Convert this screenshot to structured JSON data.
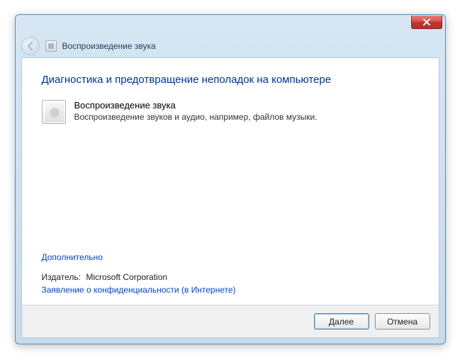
{
  "window": {
    "title": "Воспроизведение звука"
  },
  "content": {
    "heading": "Диагностика и предотвращение неполадок на компьютере",
    "troubleshooter": {
      "title": "Воспроизведение звука",
      "description": "Воспроизведение звуков и аудио, например, файлов музыки."
    },
    "advanced_link": "Дополнительно",
    "publisher_label": "Издатель:",
    "publisher_value": "Microsoft Corporation",
    "privacy_link": "Заявление о конфиденциальности (в Интернете)"
  },
  "buttons": {
    "next": "Далее",
    "cancel": "Отмена"
  },
  "icons": {
    "close": "close-icon",
    "back": "back-arrow-icon",
    "audio": "audio-troubleshoot-icon",
    "window": "window-small-icon"
  }
}
